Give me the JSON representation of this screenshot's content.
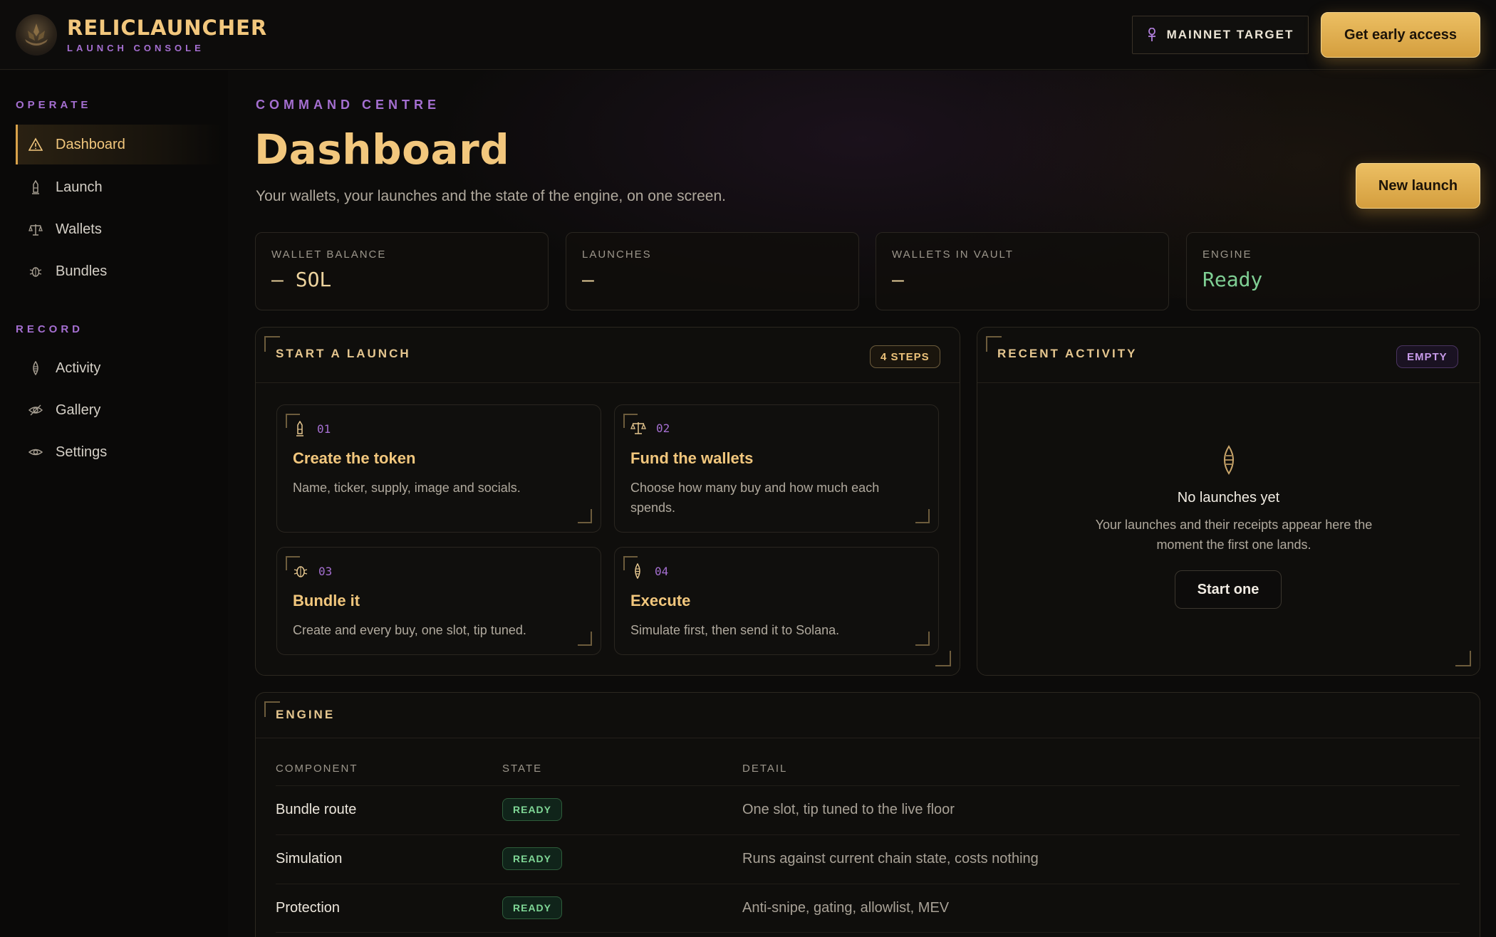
{
  "header": {
    "brand_title": "RELICLAUNCHER",
    "brand_subtitle": "LAUNCH CONSOLE",
    "logo_text": "RELIC LAUNCH",
    "network_label": "MAINNET TARGET",
    "cta_label": "Get early access"
  },
  "sidebar": {
    "sections": [
      {
        "title": "OPERATE",
        "items": [
          {
            "label": "Dashboard",
            "icon": "warning-triangle-icon",
            "active": true
          },
          {
            "label": "Launch",
            "icon": "rocket-tower-icon"
          },
          {
            "label": "Wallets",
            "icon": "scales-icon"
          },
          {
            "label": "Bundles",
            "icon": "bug-icon"
          }
        ]
      },
      {
        "title": "RECORD",
        "items": [
          {
            "label": "Activity",
            "icon": "seed-icon"
          },
          {
            "label": "Gallery",
            "icon": "eye-slash-icon"
          },
          {
            "label": "Settings",
            "icon": "eye-icon"
          }
        ]
      }
    ]
  },
  "page": {
    "eyebrow": "COMMAND CENTRE",
    "title": "Dashboard",
    "subtitle": "Your wallets, your launches and the state of the engine, on one screen.",
    "new_launch_label": "New launch"
  },
  "stats": [
    {
      "label": "WALLET BALANCE",
      "value": "— SOL"
    },
    {
      "label": "LAUNCHES",
      "value": "—"
    },
    {
      "label": "WALLETS IN VAULT",
      "value": "—"
    },
    {
      "label": "ENGINE",
      "value": "Ready",
      "status_color": "#7fcf94"
    }
  ],
  "start_launch": {
    "title": "START A LAUNCH",
    "badge": "4 STEPS",
    "steps": [
      {
        "num": "01",
        "title": "Create the token",
        "desc": "Name, ticker, supply, image and socials.",
        "icon": "rocket-tower-icon"
      },
      {
        "num": "02",
        "title": "Fund the wallets",
        "desc": "Choose how many buy and how much each spends.",
        "icon": "scales-icon"
      },
      {
        "num": "03",
        "title": "Bundle it",
        "desc": "Create and every buy, one slot, tip tuned.",
        "icon": "bug-icon"
      },
      {
        "num": "04",
        "title": "Execute",
        "desc": "Simulate first, then send it to Solana.",
        "icon": "seed-icon"
      }
    ]
  },
  "recent_activity": {
    "title": "RECENT ACTIVITY",
    "badge": "EMPTY",
    "empty_title": "No launches yet",
    "empty_desc": "Your launches and their receipts appear here the moment the first one lands.",
    "start_label": "Start one"
  },
  "engine": {
    "title": "ENGINE",
    "columns": [
      "COMPONENT",
      "STATE",
      "DETAIL"
    ],
    "rows": [
      {
        "component": "Bundle route",
        "state": "READY",
        "detail": "One slot, tip tuned to the live floor"
      },
      {
        "component": "Simulation",
        "state": "READY",
        "detail": "Runs against current chain state, costs nothing"
      },
      {
        "component": "Protection",
        "state": "READY",
        "detail": "Anti-snipe, gating, allowlist, MEV"
      }
    ]
  },
  "colors": {
    "accent_gold": "#f2c77d",
    "accent_purple": "#a56fd1",
    "status_ready": "#7fd796",
    "background": "#0c0b0a"
  }
}
